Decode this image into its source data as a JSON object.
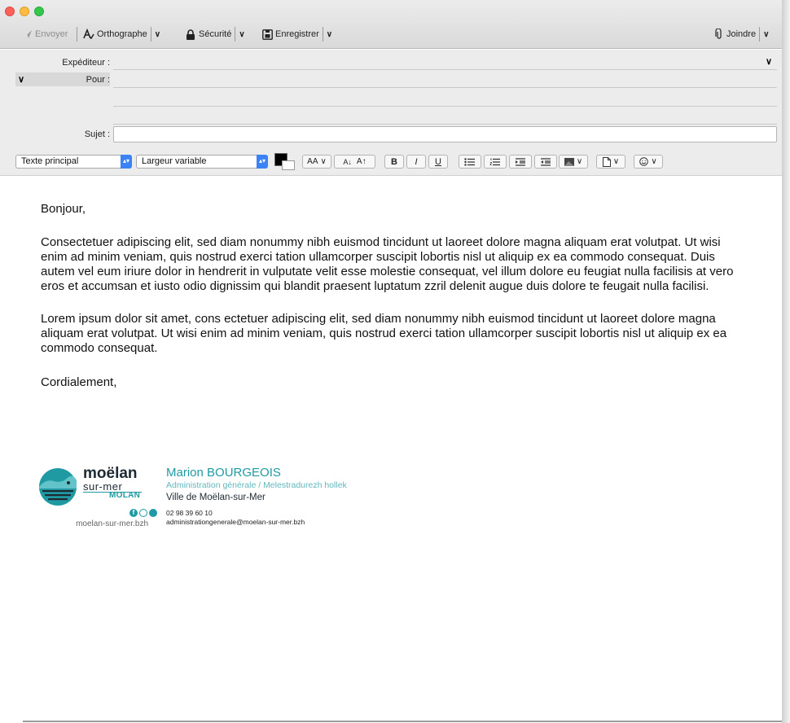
{
  "toolbar": {
    "send_label": "Envoyer",
    "spelling_label": "Orthographe",
    "security_label": "Sécurité",
    "save_label": "Enregistrer",
    "attach_label": "Joindre"
  },
  "header": {
    "from_label": "Expéditeur :",
    "to_label": "Pour :",
    "subject_label": "Sujet :"
  },
  "format_bar": {
    "style_value": "Texte principal",
    "width_value": "Largeur variable",
    "font_size_label": "AA",
    "text_color": "#000000"
  },
  "body": {
    "greeting": "Bonjour,",
    "paragraph1": "Consectetuer adipiscing elit, sed diam nonummy nibh euismod tincidunt ut laoreet dolore magna aliquam erat volutpat. Ut wisi enim ad minim veniam, quis nostrud exerci tation ullamcorper suscipit lobortis nisl ut aliquip ex ea commodo consequat. Duis autem vel eum iriure dolor in hendrerit in vulputate velit esse molestie consequat, vel illum dolore eu feugiat nulla facilisis at vero eros et accumsan et iusto odio dignissim qui blandit praesent luptatum zzril delenit augue duis dolore te feugait nulla facilisi.",
    "paragraph2": "Lorem ipsum dolor sit amet, cons ectetuer adipiscing elit, sed diam nonummy nibh euismod tincidunt ut laoreet dolore magna aliquam erat volutpat. Ut wisi enim ad minim veniam, quis nostrud exerci tation ullamcorper suscipit lobortis nisl ut aliquip ex ea commodo consequat.",
    "closing": "Cordialement,"
  },
  "signature": {
    "logo_main": "moëlan",
    "logo_sub": "sur-mer",
    "logo_breton": "MOLAN",
    "website": "moelan-sur-mer.bzh",
    "name": "Marion BOURGEOIS",
    "role": "Administration générale / Melestradurezh hollek",
    "organization": "Ville de Moëlan-sur-Mer",
    "phone": "02 98 39 60 10",
    "email": "administrationgenerale@moelan-sur-mer.bzh"
  },
  "colors": {
    "accent_teal": "#1f9aa3",
    "teal_light": "#62b7bd",
    "dark": "#1e2a33"
  }
}
